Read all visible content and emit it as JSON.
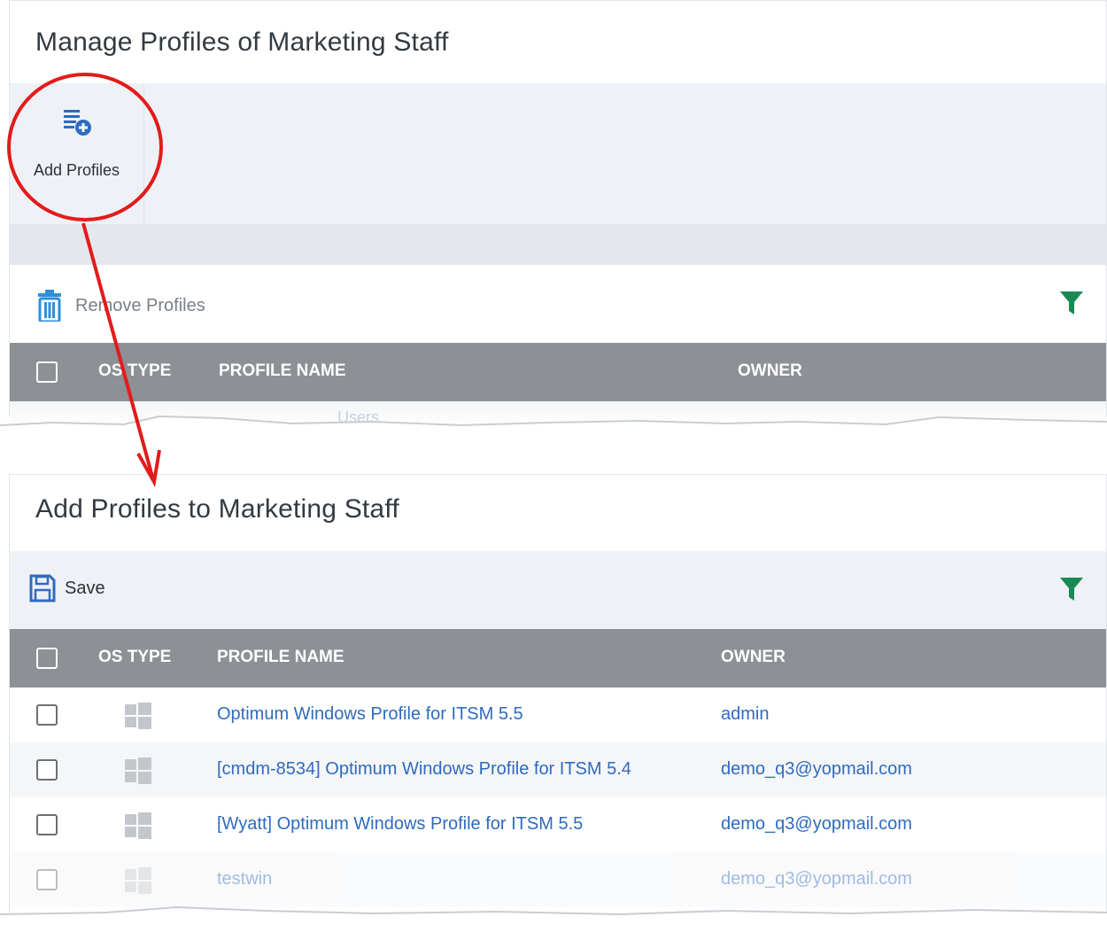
{
  "manage_panel": {
    "title": "Manage Profiles of Marketing Staff",
    "add_button_label": "Add Profiles",
    "add_icon": "list-add-icon",
    "remove_label": "Remove Profiles",
    "remove_icon": "trash-icon",
    "filter_icon": "filter-icon",
    "columns": [
      "OS TYPE",
      "PROFILE NAME",
      "OWNER"
    ],
    "partial_row_text": "Users"
  },
  "add_panel": {
    "title": "Add Profiles to Marketing Staff",
    "save_label": "Save",
    "save_icon": "save-icon",
    "filter_icon": "filter-icon",
    "columns": [
      "OS TYPE",
      "PROFILE NAME",
      "OWNER"
    ],
    "rows": [
      {
        "os": "windows-icon",
        "profile_name": "Optimum Windows Profile for ITSM 5.5",
        "owner": "admin"
      },
      {
        "os": "windows-icon",
        "profile_name": "[cmdm-8534] Optimum Windows Profile for ITSM 5.4",
        "owner": "demo_q3@yopmail.com"
      },
      {
        "os": "windows-icon",
        "profile_name": "[Wyatt] Optimum Windows Profile for ITSM 5.5",
        "owner": "demo_q3@yopmail.com"
      },
      {
        "os": "windows-icon",
        "profile_name": "testwin",
        "owner": "demo_q3@yopmail.com"
      }
    ]
  },
  "colors": {
    "link": "#2f6bbd",
    "header_bg": "#8d9095",
    "toolbar_bg": "#eef1f5",
    "filter_green": "#1a8a55",
    "annotation_red": "#e31b1b"
  }
}
